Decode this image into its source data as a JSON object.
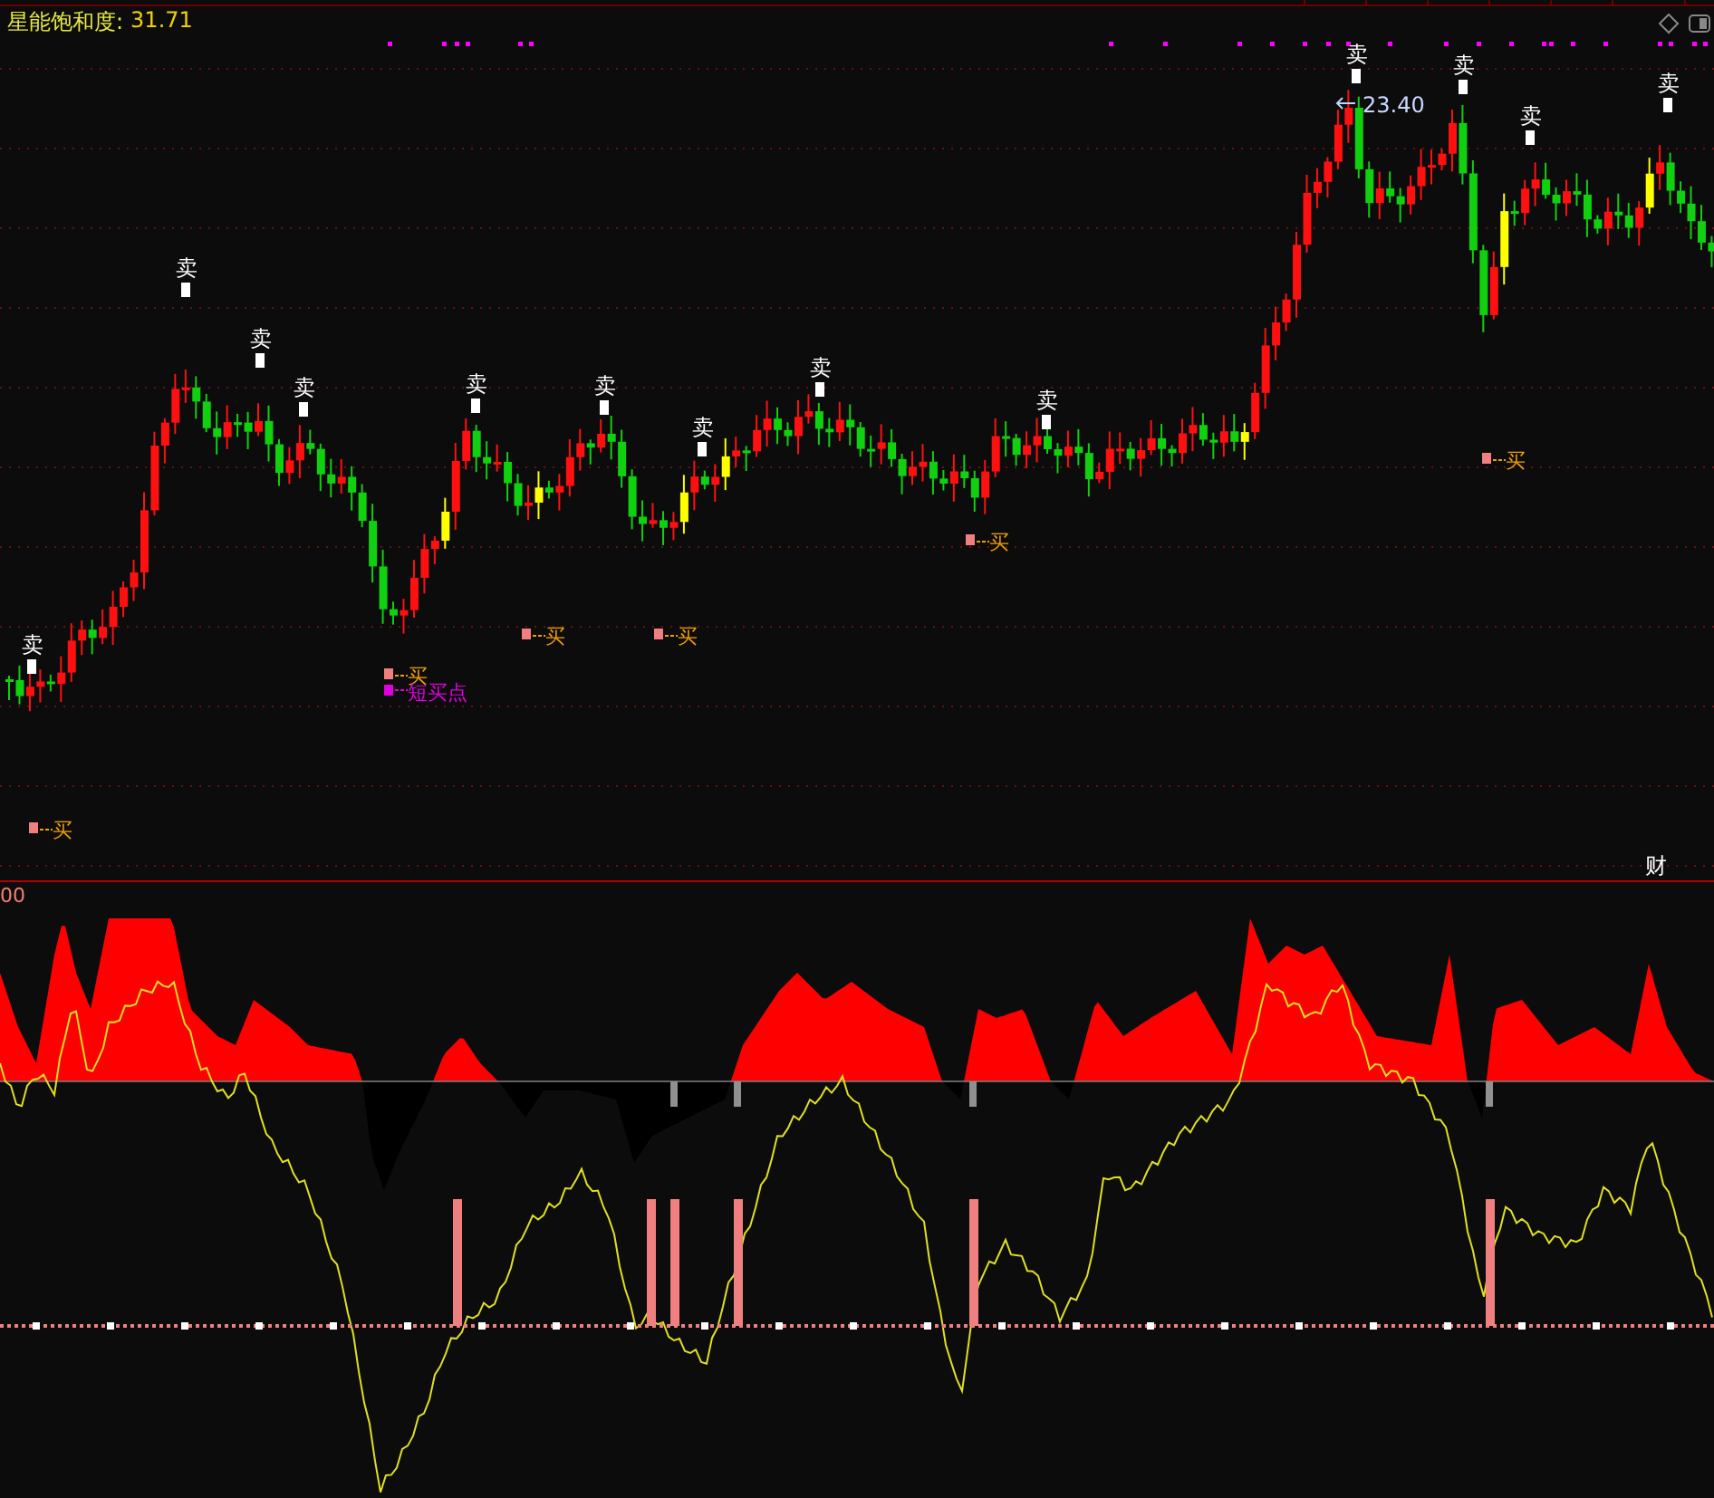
{
  "indicator": {
    "name": "星能饱和度:",
    "value": "31.71"
  },
  "price_chart": {
    "high_label": "23.40",
    "badge": "财",
    "signals": [
      {
        "kind": "sell",
        "text": "卖"
      },
      {
        "kind": "sell",
        "text": "卖"
      },
      {
        "kind": "sell",
        "text": "卖"
      },
      {
        "kind": "sell",
        "text": "卖"
      },
      {
        "kind": "sell",
        "text": "卖"
      },
      {
        "kind": "sell",
        "text": "卖"
      },
      {
        "kind": "sell",
        "text": "卖"
      },
      {
        "kind": "sell",
        "text": "卖"
      },
      {
        "kind": "sell",
        "text": "卖"
      },
      {
        "kind": "sell",
        "text": "卖"
      },
      {
        "kind": "sell",
        "text": "卖"
      },
      {
        "kind": "sell",
        "text": "卖"
      },
      {
        "kind": "sell",
        "text": "卖"
      },
      {
        "kind": "buy",
        "text": "买"
      },
      {
        "kind": "buy",
        "text": "买"
      },
      {
        "kind": "short_buy",
        "text": "短买点"
      },
      {
        "kind": "buy",
        "text": "买"
      },
      {
        "kind": "buy",
        "text": "买"
      },
      {
        "kind": "buy",
        "text": "买"
      },
      {
        "kind": "buy",
        "text": "买"
      }
    ]
  },
  "lower_panel": {
    "axis_label": "00"
  }
}
